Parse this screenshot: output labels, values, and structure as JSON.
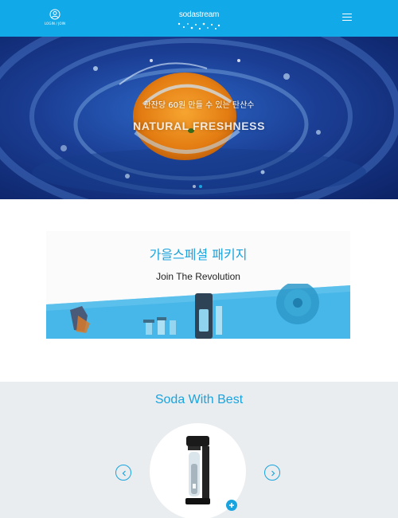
{
  "header": {
    "user_label": "LOGIN / JOIN",
    "logo_text": "sodastream",
    "accent_color": "#11a9e8",
    "icons": [
      "user-icon",
      "hamburger-menu-icon"
    ]
  },
  "hero": {
    "subtitle": "한잔당 60원 만들 수 있는 탄산수",
    "title": "NATURAL FRESHNESS",
    "slide_count": 2,
    "active_slide": 2
  },
  "package_card": {
    "title": "가을스페셜 패키지",
    "subtitle": "Join The Revolution"
  },
  "soda_section": {
    "title": "Soda With Best",
    "icons": [
      "chevron-left-icon",
      "chevron-right-icon",
      "plus-icon"
    ],
    "accent_color": "#19a4df"
  }
}
